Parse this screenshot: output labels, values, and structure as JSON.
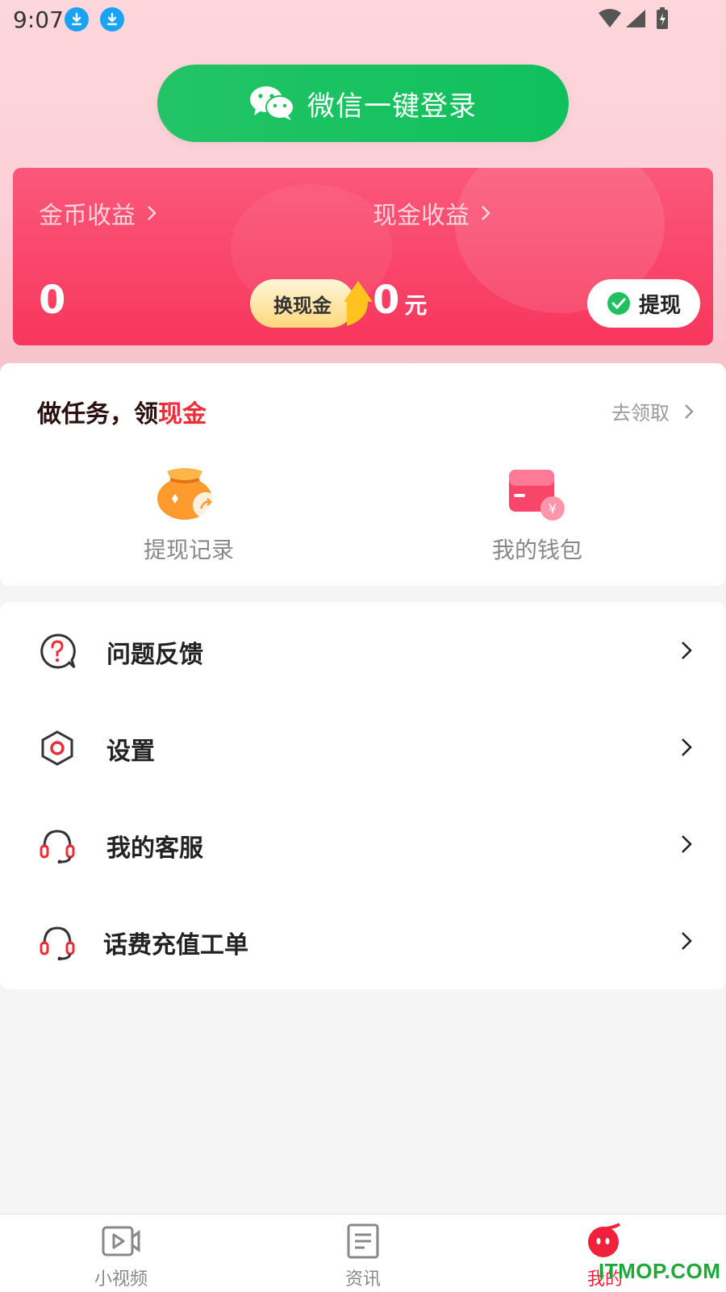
{
  "status_bar": {
    "time": "9:07"
  },
  "login": {
    "label": "微信一键登录"
  },
  "earnings": {
    "coin_label": "金币收益",
    "coin_value": "0",
    "exchange_label": "换现金",
    "cash_label": "现金收益",
    "cash_value": "0",
    "cash_unit": "元",
    "withdraw_label": "提现"
  },
  "tasks": {
    "title_main": "做任务，领",
    "title_accent": "现金",
    "link": "去领取",
    "items": [
      {
        "label": "提现记录",
        "icon": "money-bag-icon"
      },
      {
        "label": "我的钱包",
        "icon": "wallet-icon"
      }
    ]
  },
  "menu": [
    {
      "label": "问题反馈",
      "icon": "feedback-question-icon"
    },
    {
      "label": "设置",
      "icon": "settings-hexagon-icon"
    },
    {
      "label": "我的客服",
      "icon": "headset-icon"
    },
    {
      "label": "话费充值工单",
      "icon": "headset-icon"
    }
  ],
  "nav": [
    {
      "label": "小视频",
      "icon": "video-icon"
    },
    {
      "label": "资讯",
      "icon": "news-icon"
    },
    {
      "label": "我的",
      "icon": "profile-face-icon"
    }
  ],
  "watermark": "ITMOP.COM",
  "colors": {
    "accent": "#f0223b",
    "wechat_green": "#10c05c",
    "card_pink": "#f8365c"
  }
}
